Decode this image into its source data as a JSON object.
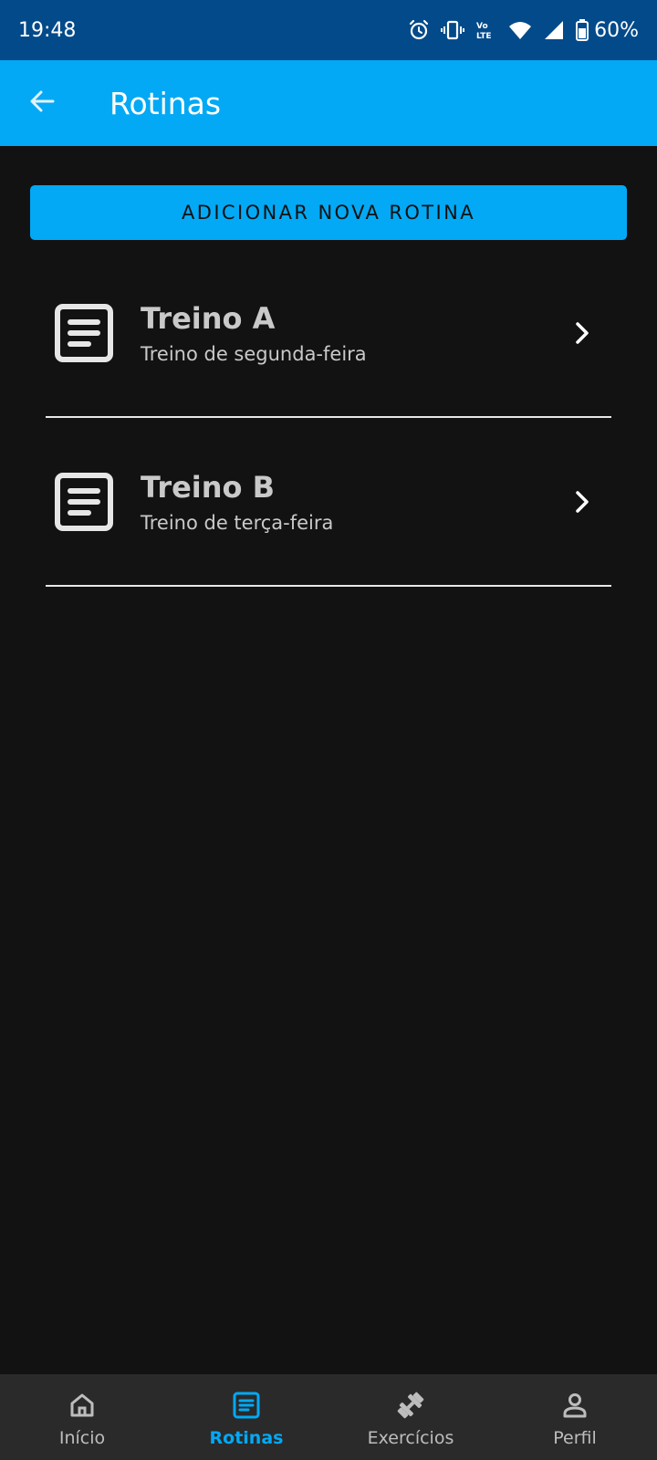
{
  "status_bar": {
    "time": "19:48",
    "battery": "60%",
    "icons": [
      "alarm-icon",
      "vibrate-icon",
      "volte-icon",
      "wifi-icon",
      "signal-icon",
      "battery-icon"
    ]
  },
  "app_bar": {
    "title": "Rotinas",
    "back_icon": "arrow-back-icon"
  },
  "main": {
    "add_button_label": "ADICIONAR NOVA ROTINA",
    "routines": [
      {
        "title": "Treino A",
        "subtitle": "Treino de segunda-feira",
        "icon": "list-document-icon"
      },
      {
        "title": "Treino B",
        "subtitle": "Treino de terça-feira",
        "icon": "list-document-icon"
      }
    ]
  },
  "bottom_nav": {
    "items": [
      {
        "label": "Início",
        "icon": "home-icon",
        "active": false
      },
      {
        "label": "Rotinas",
        "icon": "list-document-icon",
        "active": true
      },
      {
        "label": "Exercícios",
        "icon": "dumbbell-icon",
        "active": false
      },
      {
        "label": "Perfil",
        "icon": "person-icon",
        "active": false
      }
    ]
  },
  "colors": {
    "status_bar": "#034a8a",
    "accent": "#03a9f4",
    "background": "#121212",
    "nav_background": "#2a2a2a"
  }
}
